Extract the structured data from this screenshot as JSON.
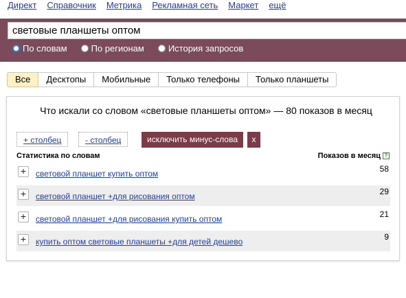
{
  "topnav": [
    "Директ",
    "Справочник",
    "Метрика",
    "Рекламная сеть",
    "Маркет",
    "ещё"
  ],
  "search": {
    "value": "световые планшеты оптом"
  },
  "radios": [
    {
      "label": "По словам",
      "checked": true
    },
    {
      "label": "По регионам",
      "checked": false
    },
    {
      "label": "История запросов",
      "checked": false
    }
  ],
  "tabs": [
    "Все",
    "Десктопы",
    "Мобильные",
    "Только телефоны",
    "Только планшеты"
  ],
  "headline": "Что искали со словом «световые планшеты оптом» — 80 показов в месяц",
  "buttons": {
    "add_col": "+ столбец",
    "remove_col": "- столбец",
    "exclude": "исключить минус-слова",
    "close": "x"
  },
  "columns": {
    "left": "Статистика по словам",
    "right": "Показов в месяц"
  },
  "rows": [
    {
      "keyword": "световой планшет купить оптом",
      "count": "58"
    },
    {
      "keyword": "световой планшет +для рисования оптом",
      "count": "29"
    },
    {
      "keyword": "световой планшет +для рисования купить оптом",
      "count": "21"
    },
    {
      "keyword": "купить оптом световые планшеты +для детей дешево",
      "count": "9"
    }
  ],
  "colors": {
    "band": "#7b4a5b",
    "accent_button": "#7b3b47",
    "link": "#1a3dc1"
  },
  "icons": {
    "plus": "plus-icon",
    "help": "help-icon"
  }
}
